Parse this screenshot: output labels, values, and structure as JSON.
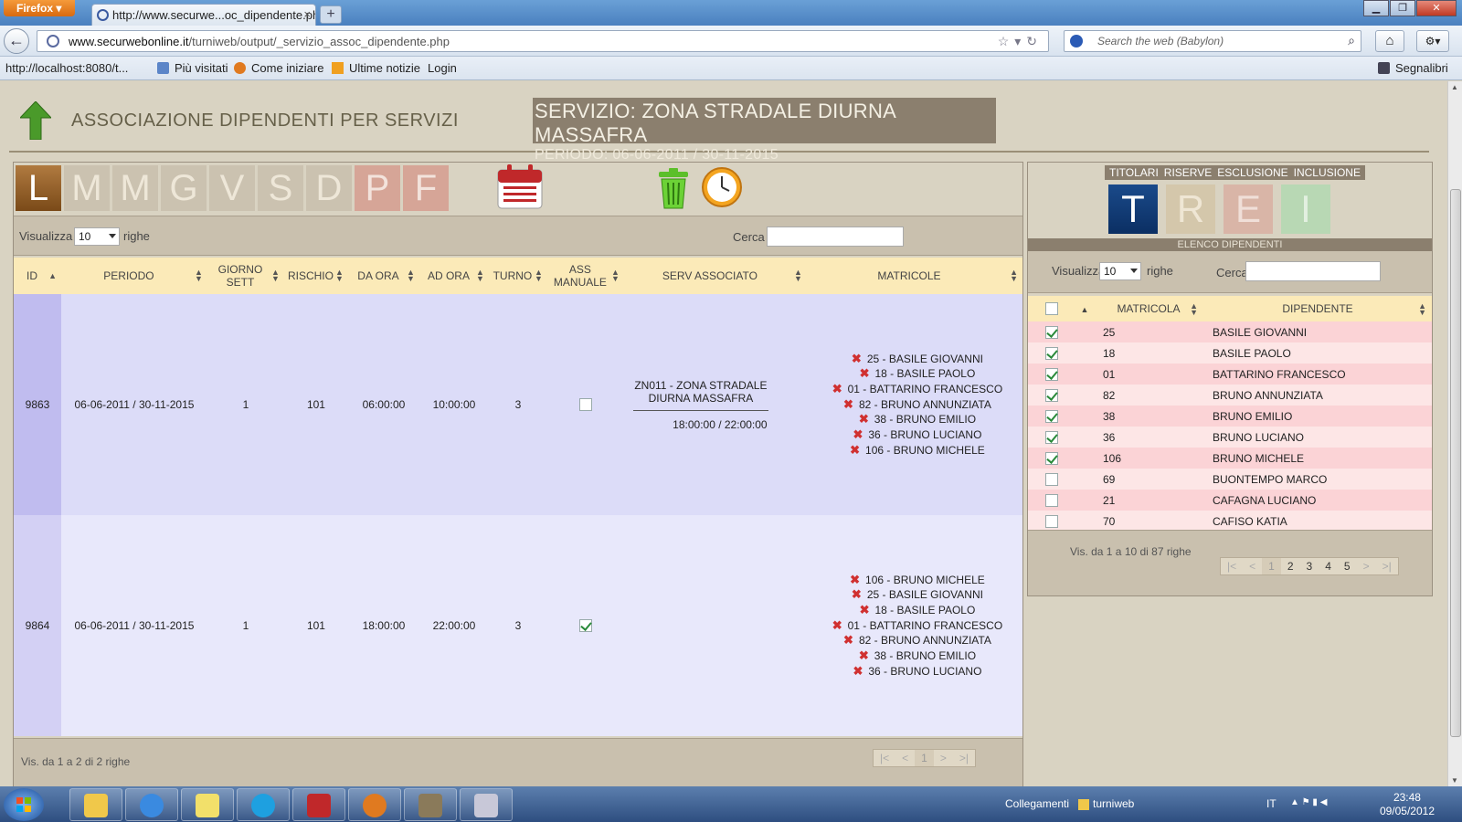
{
  "browser": {
    "app_button": "Firefox",
    "tab_title": "http://www.securwe...oc_dipendente.php",
    "url_domain": "www.securwebonline.it",
    "url_path": "/turniweb/output/_servizio_assoc_dipendente.php",
    "search_placeholder": "Search the web (Babylon)",
    "bookmarks": [
      "http://localhost:8080/t...",
      "Più visitati",
      "Come iniziare",
      "Ultime notizie",
      "Login"
    ],
    "bookmarks_menu": "Segnalibri"
  },
  "header": {
    "title": "ASSOCIAZIONE DIPENDENTI PER SERVIZI",
    "service_line": "SERVIZIO:  ZONA STRADALE DIURNA MASSAFRA",
    "period_line": "PERIODO: 06-06-2011 / 30-11-2015"
  },
  "days": [
    "L",
    "M",
    "M",
    "G",
    "V",
    "S",
    "D",
    "P",
    "F"
  ],
  "left": {
    "show_label": "Visualizza",
    "rows_label": "righe",
    "page_size": "10",
    "search_label": "Cerca",
    "columns": [
      "ID",
      "PERIODO",
      "GIORNO SETT",
      "RISCHIO",
      "DA ORA",
      "AD ORA",
      "TURNO",
      "ASS MANUALE",
      "SERV ASSOCIATO",
      "MATRICOLE"
    ],
    "rows": [
      {
        "id": "9863",
        "periodo": "06-06-2011 / 30-11-2015",
        "giorno": "1",
        "rischio": "101",
        "da_ora": "06:00:00",
        "ad_ora": "10:00:00",
        "turno": "3",
        "ass_manuale": false,
        "serv_name": "ZN011 - ZONA STRADALE DIURNA MASSAFRA",
        "serv_time": "18:00:00 / 22:00:00",
        "matricole": [
          "25 - BASILE GIOVANNI",
          "18 - BASILE PAOLO",
          "01 - BATTARINO FRANCESCO",
          "82 - BRUNO ANNUNZIATA",
          "38 - BRUNO EMILIO",
          "36 - BRUNO LUCIANO",
          "106 - BRUNO MICHELE"
        ]
      },
      {
        "id": "9864",
        "periodo": "06-06-2011 / 30-11-2015",
        "giorno": "1",
        "rischio": "101",
        "da_ora": "18:00:00",
        "ad_ora": "22:00:00",
        "turno": "3",
        "ass_manuale": true,
        "serv_name": "",
        "serv_time": "",
        "matricole": [
          "106 - BRUNO MICHELE",
          "25 - BASILE GIOVANNI",
          "18 - BASILE PAOLO",
          "01 - BATTARINO FRANCESCO",
          "82 - BRUNO ANNUNZIATA",
          "38 - BRUNO EMILIO",
          "36 - BRUNO LUCIANO"
        ]
      }
    ],
    "footer_info": "Vis. da 1 a 2 di 2 righe",
    "pager": [
      "|<",
      "<",
      "1",
      ">",
      ">|"
    ]
  },
  "right": {
    "tab_labels": [
      "TITOLARI",
      "RISERVE",
      "ESCLUSIONE",
      "INCLUSIONE"
    ],
    "tab_letters": [
      "T",
      "R",
      "E",
      "I"
    ],
    "list_title": "ELENCO DIPENDENTI",
    "show_label": "Visualizza",
    "rows_label": "righe",
    "page_size": "10",
    "search_label": "Cerca",
    "col_matricola": "MATRICOLA",
    "col_dipendente": "DIPENDENTE",
    "employees": [
      {
        "matricola": "25",
        "nome": "BASILE GIOVANNI",
        "checked": true
      },
      {
        "matricola": "18",
        "nome": "BASILE PAOLO",
        "checked": true
      },
      {
        "matricola": "01",
        "nome": "BATTARINO FRANCESCO",
        "checked": true
      },
      {
        "matricola": "82",
        "nome": "BRUNO ANNUNZIATA",
        "checked": true
      },
      {
        "matricola": "38",
        "nome": "BRUNO EMILIO",
        "checked": true
      },
      {
        "matricola": "36",
        "nome": "BRUNO LUCIANO",
        "checked": true
      },
      {
        "matricola": "106",
        "nome": "BRUNO MICHELE",
        "checked": true
      },
      {
        "matricola": "69",
        "nome": "BUONTEMPO MARCO",
        "checked": false
      },
      {
        "matricola": "21",
        "nome": "CAFAGNA LUCIANO",
        "checked": false
      },
      {
        "matricola": "70",
        "nome": "CAFISO KATIA",
        "checked": false
      }
    ],
    "footer_info": "Vis. da 1 a 10 di 87 righe",
    "pager": [
      "|<",
      "<",
      "1",
      "2",
      "3",
      "4",
      "5",
      ">",
      ">|"
    ]
  },
  "taskbar": {
    "toolbar_label": "Collegamenti",
    "folder_label": "turniweb",
    "lang": "IT",
    "time": "23:48",
    "date": "09/05/2012"
  }
}
